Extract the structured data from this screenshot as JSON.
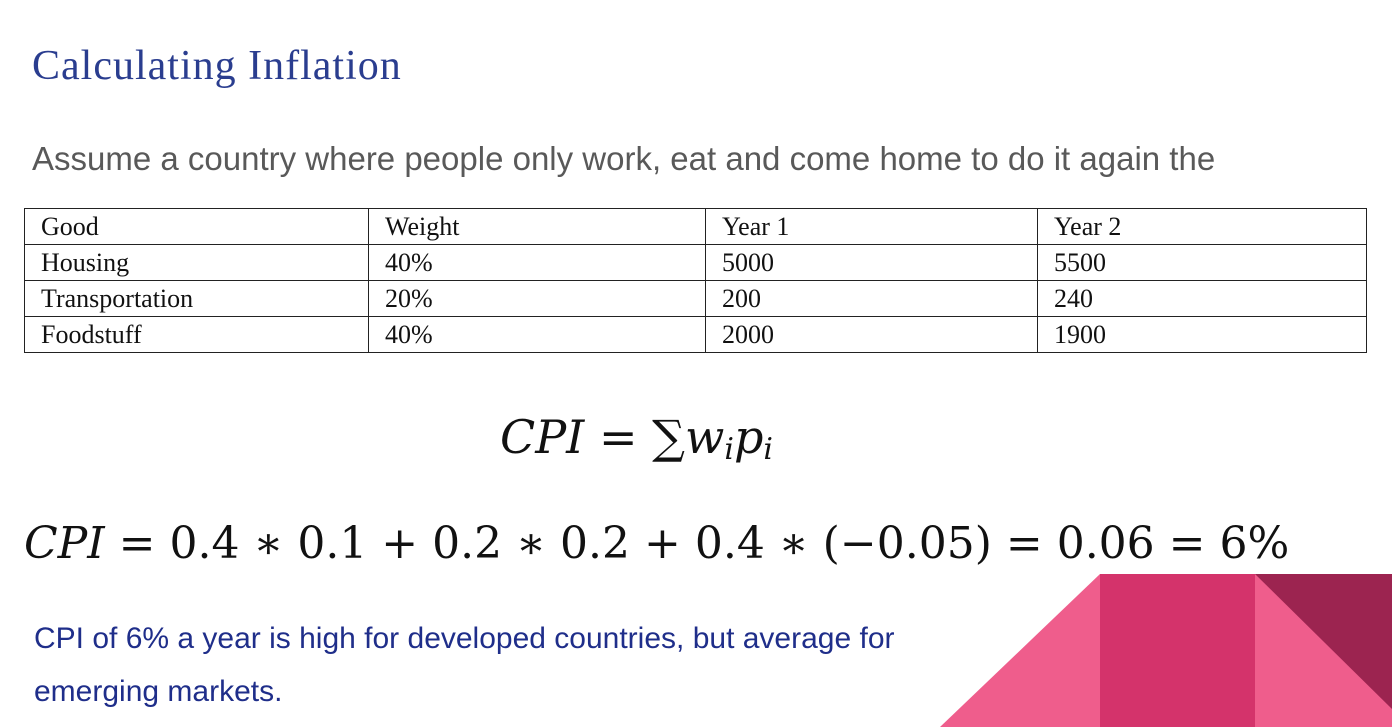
{
  "slide": {
    "title": "Calculating Inflation",
    "intro": "Assume a country where people only work, eat and come home to do it again the",
    "table": {
      "header": [
        "Good",
        "Weight",
        "Year 1",
        "Year 2"
      ],
      "rows": [
        [
          "Housing",
          "40%",
          "5000",
          "5500"
        ],
        [
          "Transportation",
          "20%",
          "200",
          "240"
        ],
        [
          "Foodstuff",
          "40%",
          "2000",
          "1900"
        ]
      ]
    },
    "formula_general": {
      "lhs": "CPI",
      "eq": "=",
      "sum": "∑",
      "w": "w",
      "w_sub": "i",
      "p": "p",
      "p_sub": "i"
    },
    "formula_computed": {
      "lhs": "CPI",
      "rhs": " = 0.4 ∗ 0.1 + 0.2 ∗ 0.2 + 0.4 ∗ (−0.05) = 0.06 = 6%"
    },
    "conclusion": "CPI of 6% a year is high for developed countries, but average for emerging markets.",
    "colors": {
      "title": "#2a3d8f",
      "conclusion": "#1f2e8a",
      "deco_light": "#ef5d8c",
      "deco_mid": "#d4336b",
      "deco_dark": "#9c2450"
    }
  }
}
